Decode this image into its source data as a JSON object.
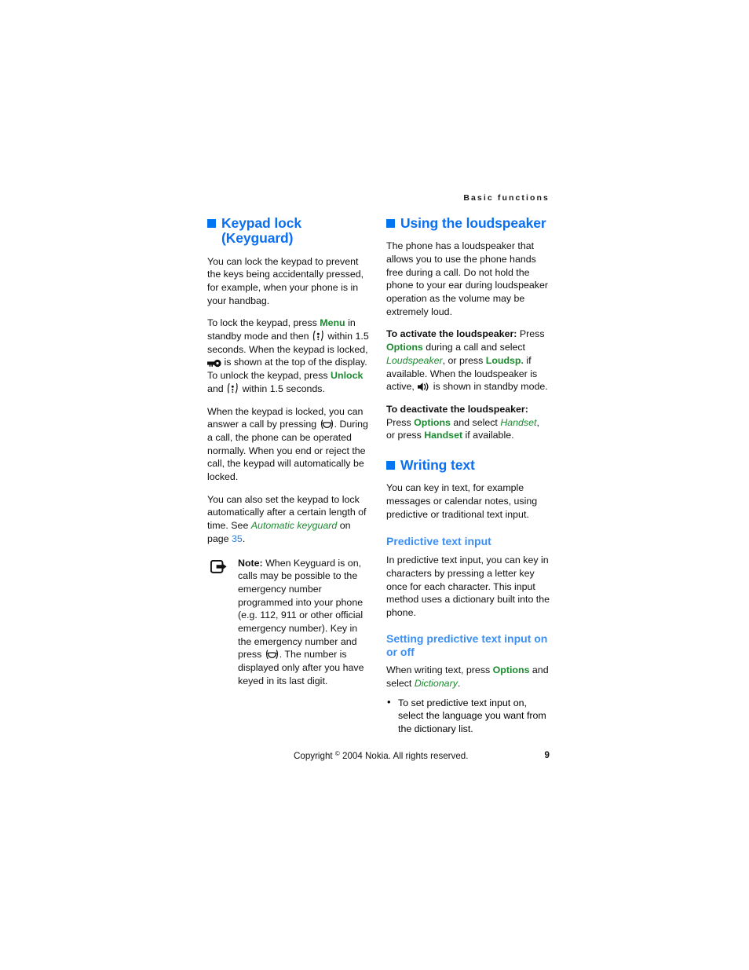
{
  "page": {
    "running_head": "Basic functions",
    "page_number": "9",
    "copyright": "Copyright",
    "copyright_symbol": "©",
    "copyright_rest": "2004 Nokia. All rights reserved."
  },
  "colors": {
    "heading_blue": "#0075f2",
    "subheading_blue": "#3a8ff5",
    "green_bold": "#1a8a2e",
    "link_blue": "#2e7de0",
    "body_black": "#101010"
  },
  "left_column": {
    "section": {
      "title": "Keypad lock (Keyguard)",
      "bullet_icon": "blue-square-bullet"
    },
    "p1": "You can lock the keypad to prevent the keys being accidentally pressed, for example, when your phone is in your handbag.",
    "p2": {
      "t1": "To lock the keypad, press ",
      "k1": "Menu",
      "t2": " in standby mode and then ",
      "icon1": "star-key-icon",
      "t3": " within 1.5 seconds. When the keypad is locked, ",
      "icon2": "keyguard-key-icon",
      "t4": " is shown at the top of the display. To unlock the keypad, press ",
      "k2": "Unlock",
      "t5": " and ",
      "icon3": "star-key-icon",
      "t6": " within 1.5 seconds."
    },
    "p3": {
      "t1": "When the keypad is locked, you can answer a call by pressing ",
      "icon1": "call-key-icon",
      "t2": ". During a call, the phone can be operated normally. When you end or reject the call, the keypad will automatically be locked."
    },
    "p4": {
      "t1": "You can also set the keypad to lock automatically after a certain length of time. See ",
      "ref": "Automatic keyguard",
      "t2": " on page ",
      "page_link": "35",
      "t3": "."
    },
    "note": {
      "icon": "note-arrow-icon",
      "label": "Note:",
      "text": " When Keyguard is on, calls may be possible to the emergency number programmed into your phone (e.g. 112, 911 or other official emergency number). Key in the emergency number and press ",
      "icon2": "call-key-icon",
      "text2": ". The number is displayed only after you have keyed in its last digit."
    }
  },
  "right_column": {
    "section1": {
      "title": "Using the loudspeaker",
      "bullet_icon": "blue-square-bullet",
      "p1": "The phone has a loudspeaker that allows you to use the phone hands free during a call. Do not hold the phone to your ear during loudspeaker operation as the volume may be extremely loud.",
      "p2": {
        "lead": "To activate the loudspeaker:",
        "t1": " Press ",
        "k1": "Options",
        "t2": " during a call and select ",
        "em1": "Loudspeaker",
        "t3": ", or press ",
        "k2": "Loudsp.",
        "t4": " if available. When the loudspeaker is active, ",
        "icon1": "loudspeaker-icon",
        "t5": " is shown in standby mode."
      },
      "p3": {
        "lead": "To deactivate the loudspeaker:",
        "t1": " Press ",
        "k1": "Options",
        "t2": " and select ",
        "em1": "Handset",
        "t3": ", or press ",
        "k2": "Handset",
        "t4": " if available."
      }
    },
    "section2": {
      "title": "Writing text",
      "bullet_icon": "blue-square-bullet",
      "p1": "You can key in text, for example messages or calendar notes, using predictive or traditional text input.",
      "sub1": {
        "title": "Predictive text input",
        "p1": "In predictive text input, you can key in characters by pressing a letter key once for each character. This input method uses a dictionary built into the phone."
      },
      "sub2": {
        "title": "Setting predictive text input on or off",
        "p1": {
          "t1": "When writing text, press ",
          "k1": "Options",
          "t2": " and select ",
          "em1": "Dictionary",
          "t3": "."
        },
        "bullets": [
          "To set predictive text input on, select the language you want from the dictionary list."
        ]
      }
    }
  }
}
